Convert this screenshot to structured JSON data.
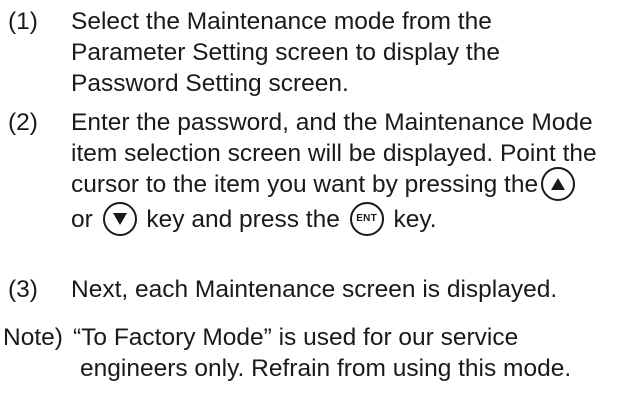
{
  "steps": [
    {
      "number": "(1)",
      "lines": [
        "Select the Maintenance mode from the",
        "Parameter Setting screen to display the",
        "Password Setting screen."
      ]
    },
    {
      "number": "(2)",
      "lines": [
        "Enter the password, and the Maintenance Mode",
        "item selection screen will be displayed. Point the",
        "cursor to the item you want by pressing the",
        "or",
        "key and press the",
        "key."
      ]
    },
    {
      "number": "(3)",
      "lines": [
        "Next, each Maintenance screen is displayed."
      ]
    }
  ],
  "keys": {
    "up_icon": "up-triangle-key",
    "down_icon": "down-triangle-key",
    "ent_label": "ENT"
  },
  "note": {
    "label": "Note)",
    "lines": [
      "“To Factory Mode” is used for our service",
      "engineers only. Refrain from using this mode."
    ]
  }
}
